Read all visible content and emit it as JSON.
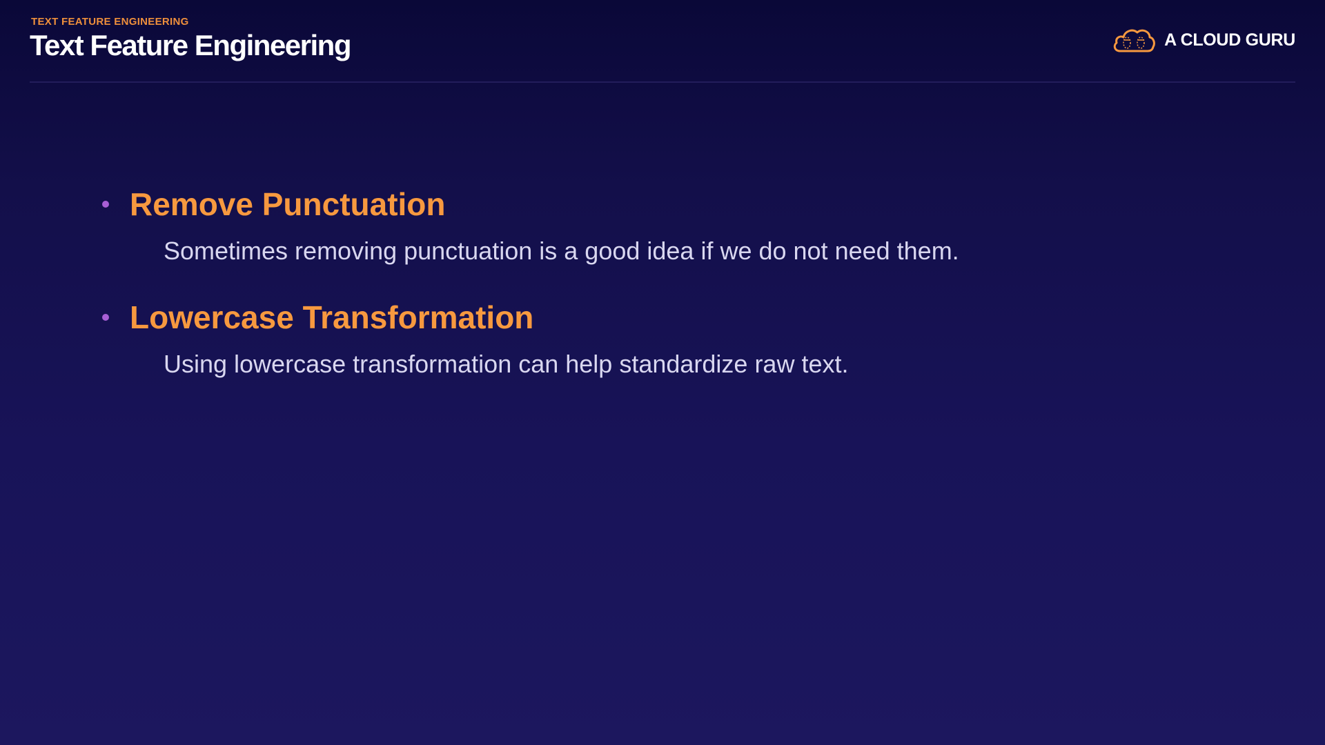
{
  "header": {
    "eyebrow": "TEXT FEATURE ENGINEERING",
    "title": "Text Feature Engineering"
  },
  "brand": {
    "name": "A CLOUD GURU",
    "icon": "cloud-icon",
    "accent_color": "#f7993f"
  },
  "bullets": [
    {
      "title": "Remove Punctuation",
      "description": "Sometimes removing punctuation is a good idea if we do not need them."
    },
    {
      "title": "Lowercase Transformation",
      "description": "Using lowercase transformation can help standardize raw text."
    }
  ],
  "colors": {
    "background": "#130f4a",
    "bullet_dot": "#a85fd6",
    "body_text": "#d9d7f0"
  }
}
